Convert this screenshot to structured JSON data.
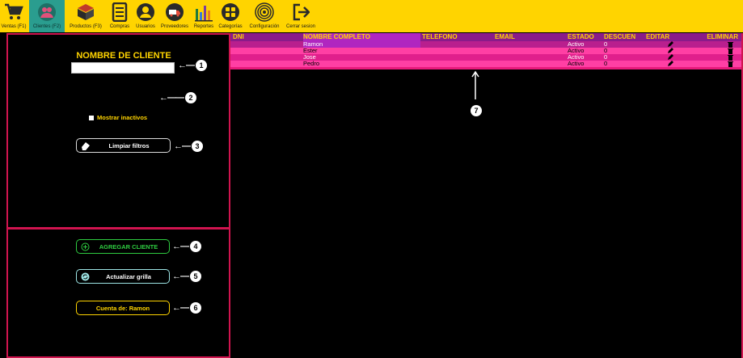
{
  "toolbar": {
    "items": [
      {
        "label": "Ventas (F1)",
        "icon": "cart-icon"
      },
      {
        "label": "Clientes (F2)",
        "icon": "clients-icon",
        "active": true
      },
      {
        "label": "Productos (F3)",
        "icon": "box-icon"
      },
      {
        "label": "Compras",
        "icon": "document-icon"
      },
      {
        "label": "Usuarios",
        "icon": "user-icon"
      },
      {
        "label": "Proveedores",
        "icon": "truck-icon"
      },
      {
        "label": "Reportes",
        "icon": "bar-chart-icon"
      },
      {
        "label": "Categorías",
        "icon": "grid-icon"
      },
      {
        "label": "Configuración",
        "icon": "target-icon"
      },
      {
        "label": "Cerrar sesion",
        "icon": "logout-icon"
      }
    ]
  },
  "filters": {
    "title": "NOMBRE DE CLIENTE",
    "name_value": "",
    "show_inactive_label": "Mostrar inactivos",
    "clear_label": "Limpiar filtros"
  },
  "actions": {
    "add_label": "AGREGAR CLIENTE",
    "refresh_label": "Actualizar grilla",
    "account_label": "Cuenta de: Ramon"
  },
  "annotations": [
    "1",
    "2",
    "3",
    "4",
    "5",
    "6",
    "7"
  ],
  "grid": {
    "columns": [
      "DNI",
      "NOMBRE COMPLETO",
      "TELEFONO",
      "EMAIL",
      "ESTADO",
      "DESCUEN",
      "EDITAR",
      "ELIMINAR"
    ],
    "rows": [
      {
        "dni": "",
        "nombre": "Ramon",
        "telefono": "",
        "email": "",
        "estado": "Activo",
        "descuento": "0"
      },
      {
        "dni": "",
        "nombre": "Ester",
        "telefono": "",
        "email": "",
        "estado": "Activo",
        "descuento": "0"
      },
      {
        "dni": "",
        "nombre": "Jose",
        "telefono": "",
        "email": "",
        "estado": "Activo",
        "descuento": "0"
      },
      {
        "dni": "",
        "nombre": "Pedro",
        "telefono": "",
        "email": "",
        "estado": "Activo",
        "descuento": "0"
      }
    ]
  },
  "colors": {
    "toolbar": "#FFD400",
    "panel_border": "#D0144F",
    "header_bg": "#8A1B8A",
    "row_pink": "#FF3FA4",
    "row_magenta": "#B91F8E"
  }
}
